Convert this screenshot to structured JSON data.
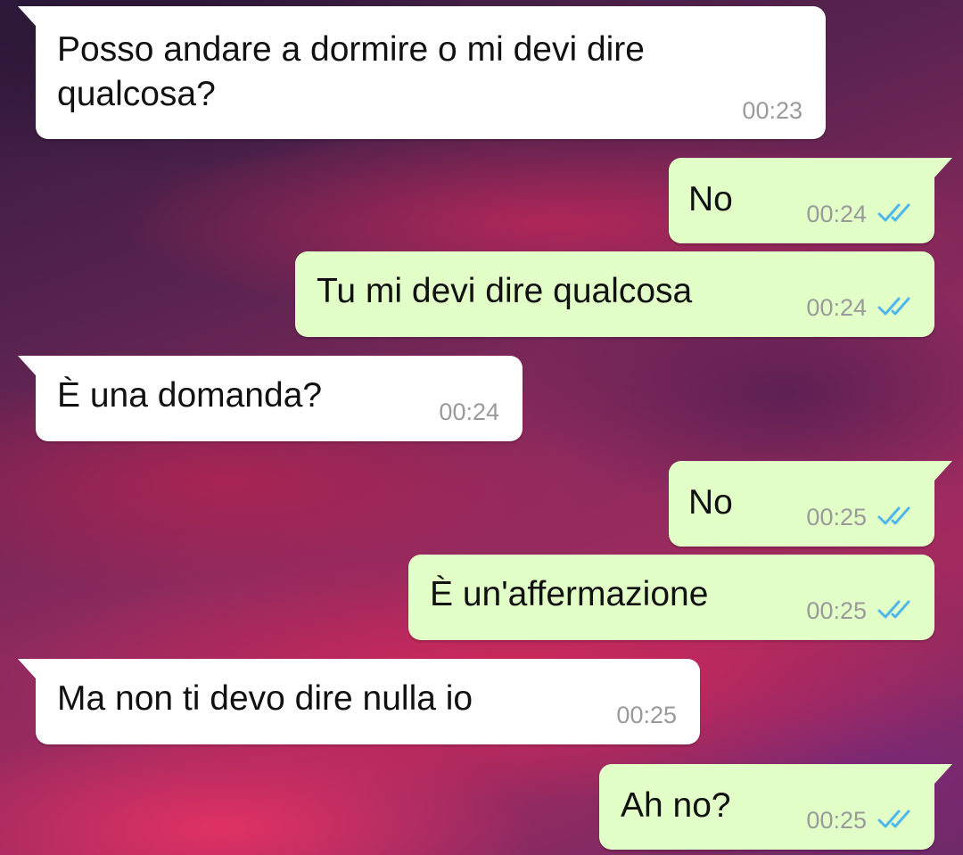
{
  "colors": {
    "incoming_bubble": "#ffffff",
    "outgoing_bubble": "#e1ffc7",
    "text": "#111111",
    "timestamp": "#9a9a9a",
    "read_ticks": "#4fb6ec"
  },
  "messages": [
    {
      "direction": "incoming",
      "text": "Posso andare a dormire o mi devi dire\nqualcosa?",
      "time": "00:23"
    },
    {
      "direction": "outgoing",
      "text": "No",
      "time": "00:24",
      "status_icon": "double-check-read-icon"
    },
    {
      "direction": "outgoing",
      "text": "Tu mi devi dire qualcosa",
      "time": "00:24",
      "status_icon": "double-check-read-icon"
    },
    {
      "direction": "incoming",
      "text": "È una domanda?",
      "time": "00:24"
    },
    {
      "direction": "outgoing",
      "text": "No",
      "time": "00:25",
      "status_icon": "double-check-read-icon"
    },
    {
      "direction": "outgoing",
      "text": "È un'affermazione",
      "time": "00:25",
      "status_icon": "double-check-read-icon"
    },
    {
      "direction": "incoming",
      "text": "Ma non ti devo dire nulla io",
      "time": "00:25"
    },
    {
      "direction": "outgoing",
      "text": "Ah no?",
      "time": "00:25",
      "status_icon": "double-check-read-icon"
    }
  ]
}
